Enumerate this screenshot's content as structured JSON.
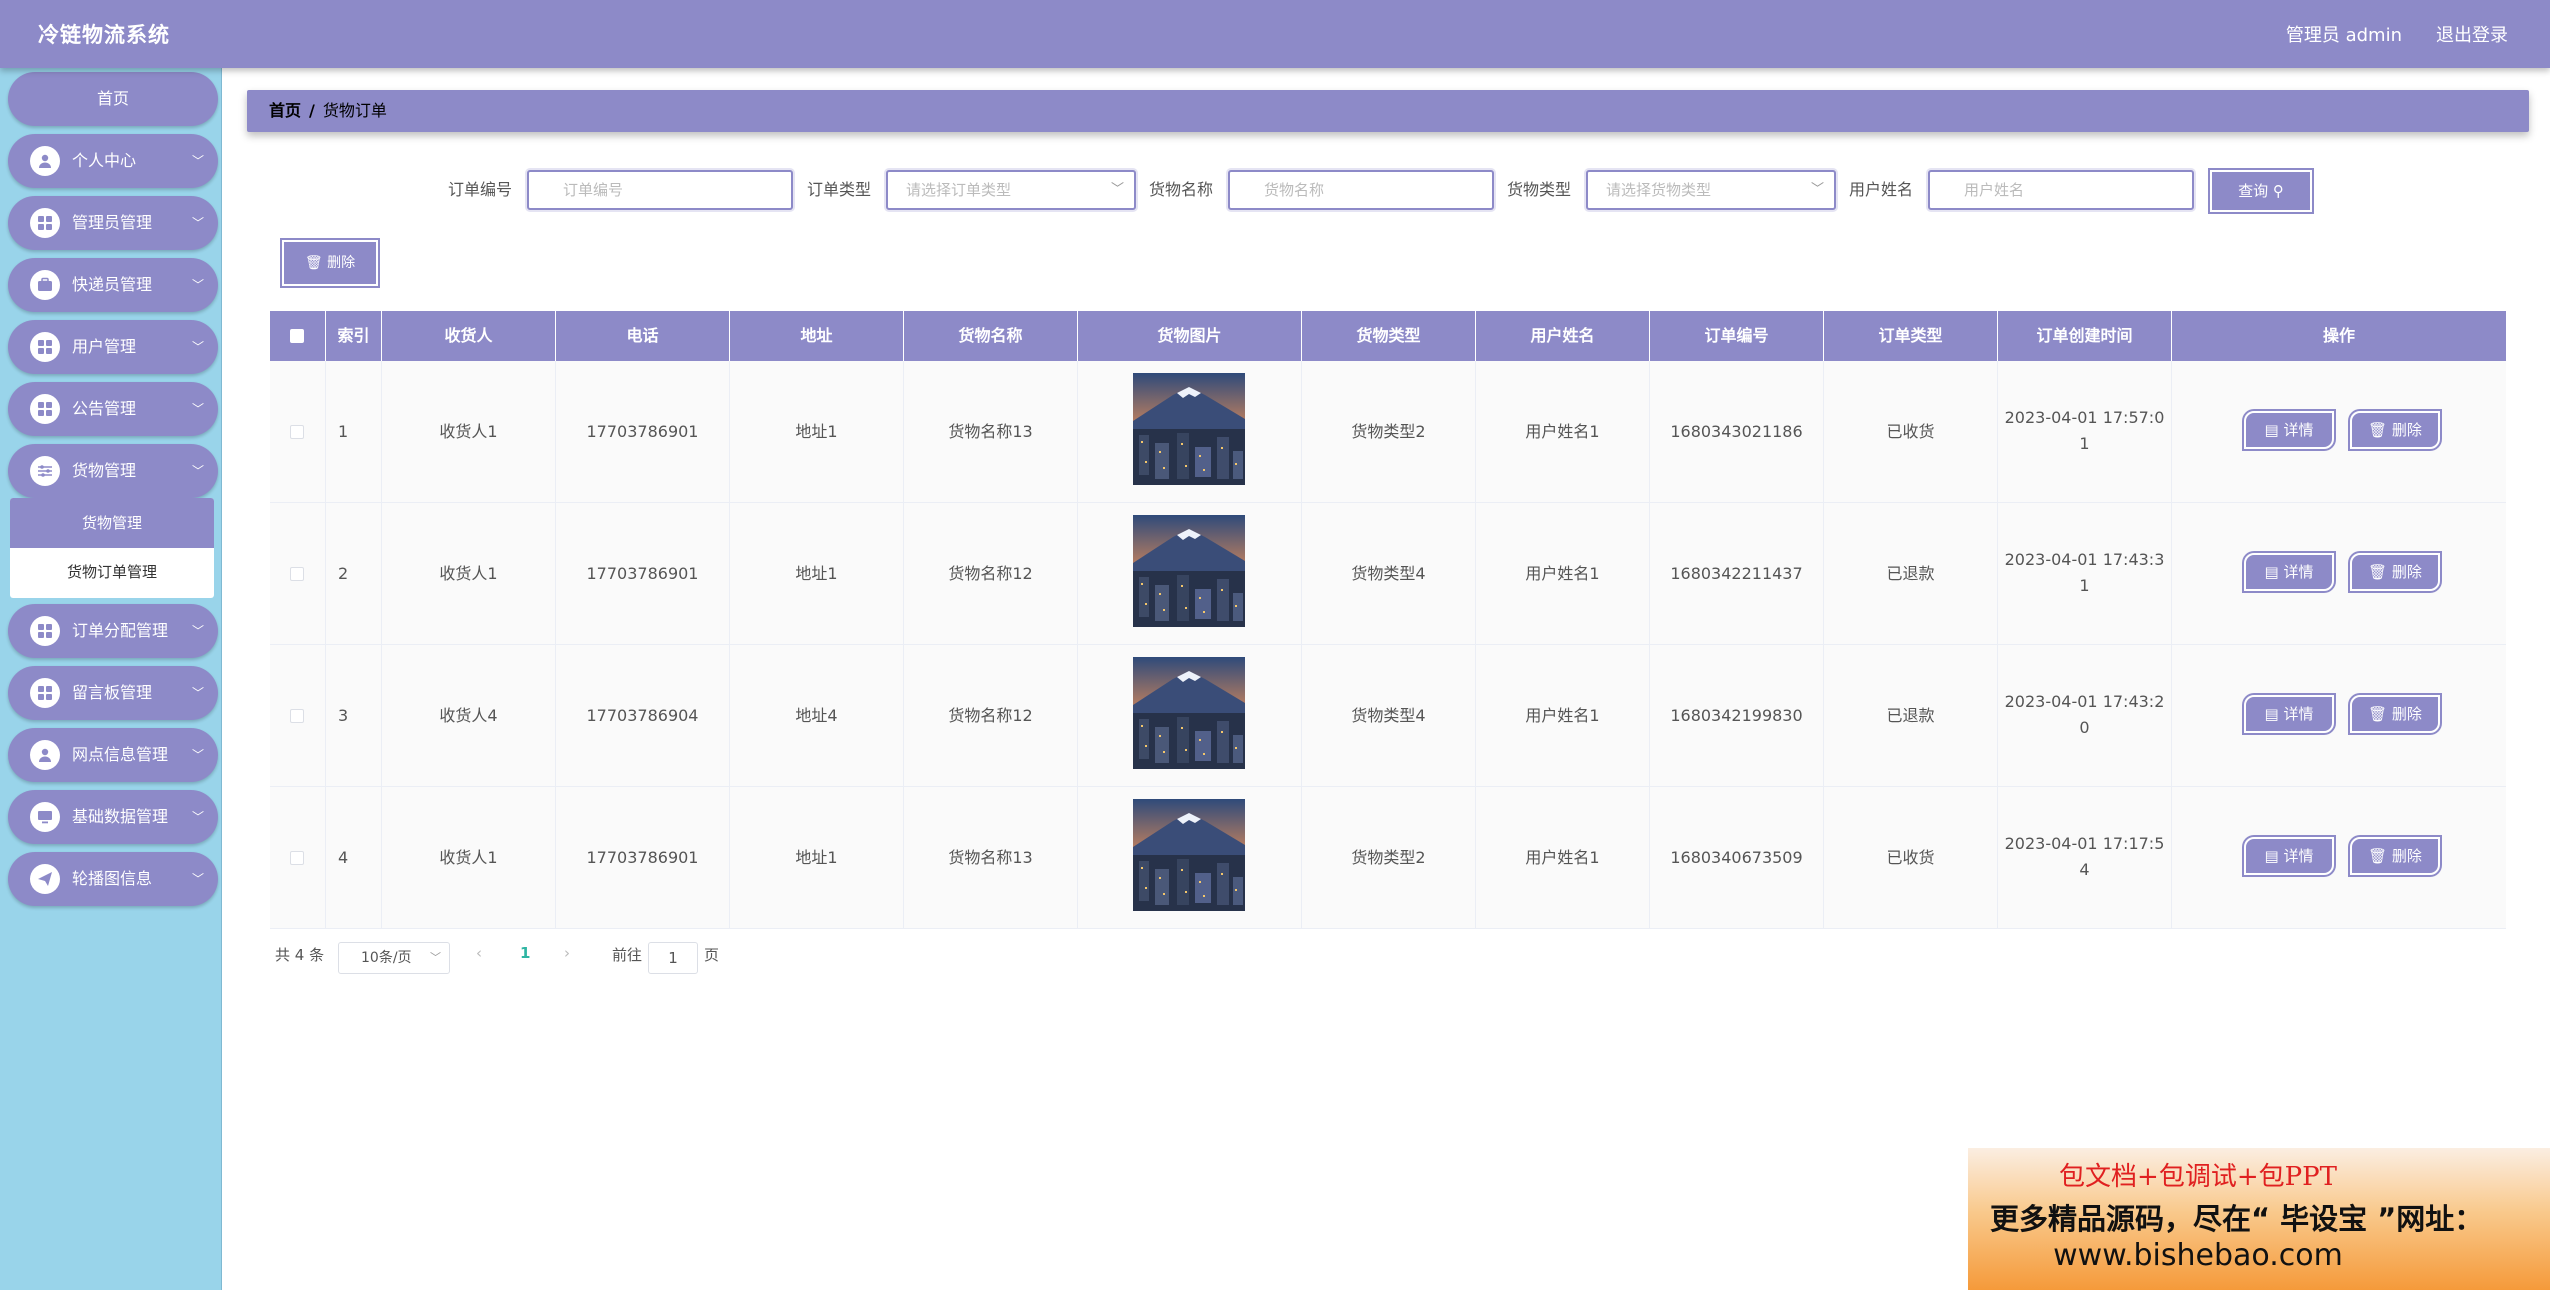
{
  "app": {
    "title": "冷链物流系统",
    "user_label": "管理员 admin",
    "logout_label": "退出登录",
    "accent_color": "#8d8ac8",
    "sidebar_color": "#99d4ea"
  },
  "sidebar": {
    "home": "首页",
    "items": [
      {
        "label": "个人中心",
        "icon": "person-icon"
      },
      {
        "label": "管理员管理",
        "icon": "grid-icon"
      },
      {
        "label": "快递员管理",
        "icon": "briefcase-icon"
      },
      {
        "label": "用户管理",
        "icon": "grid-icon"
      },
      {
        "label": "公告管理",
        "icon": "grid-icon"
      },
      {
        "label": "货物管理",
        "icon": "sliders-icon"
      },
      {
        "label": "订单分配管理",
        "icon": "grid-icon"
      },
      {
        "label": "留言板管理",
        "icon": "grid-icon"
      },
      {
        "label": "网点信息管理",
        "icon": "person-icon"
      },
      {
        "label": "基础数据管理",
        "icon": "monitor-icon"
      },
      {
        "label": "轮播图信息",
        "icon": "send-icon"
      }
    ],
    "submenu": [
      "货物管理",
      "货物订单管理"
    ]
  },
  "breadcrumb": {
    "home": "首页",
    "separator": "/",
    "current": "货物订单"
  },
  "search": {
    "order_no_label": "订单编号",
    "order_no_placeholder": "订单编号",
    "order_type_label": "订单类型",
    "order_type_placeholder": "请选择订单类型",
    "goods_name_label": "货物名称",
    "goods_name_placeholder": "货物名称",
    "goods_type_label": "货物类型",
    "goods_type_placeholder": "请选择货物类型",
    "user_name_label": "用户姓名",
    "user_name_placeholder": "用户姓名",
    "query_button": "查询"
  },
  "toolbar": {
    "delete_button": "删除"
  },
  "table": {
    "headers": [
      "索引",
      "收货人",
      "电话",
      "地址",
      "货物名称",
      "货物图片",
      "货物类型",
      "用户姓名",
      "订单编号",
      "订单类型",
      "订单创建时间",
      "操作"
    ],
    "rows": [
      {
        "index": "1",
        "receiver": "收货人1",
        "phone": "17703786901",
        "address": "地址1",
        "goods_name": "货物名称13",
        "goods_type": "货物类型2",
        "user_name": "用户姓名1",
        "order_no": "1680343021186",
        "order_type": "已收货",
        "time1": "2023-04-01 17:57:0",
        "time2": "1"
      },
      {
        "index": "2",
        "receiver": "收货人1",
        "phone": "17703786901",
        "address": "地址1",
        "goods_name": "货物名称12",
        "goods_type": "货物类型4",
        "user_name": "用户姓名1",
        "order_no": "1680342211437",
        "order_type": "已退款",
        "time1": "2023-04-01 17:43:3",
        "time2": "1"
      },
      {
        "index": "3",
        "receiver": "收货人4",
        "phone": "17703786904",
        "address": "地址4",
        "goods_name": "货物名称12",
        "goods_type": "货物类型4",
        "user_name": "用户姓名1",
        "order_no": "1680342199830",
        "order_type": "已退款",
        "time1": "2023-04-01 17:43:2",
        "time2": "0"
      },
      {
        "index": "4",
        "receiver": "收货人1",
        "phone": "17703786901",
        "address": "地址1",
        "goods_name": "货物名称13",
        "goods_type": "货物类型2",
        "user_name": "用户姓名1",
        "order_no": "1680340673509",
        "order_type": "已收货",
        "time1": "2023-04-01 17:17:5",
        "time2": "4"
      }
    ],
    "detail_button": "详情",
    "delete_button": "删除"
  },
  "pagination": {
    "total": "共 4 条",
    "page_size": "10条/页",
    "current_page": "1",
    "goto_prefix": "前往",
    "goto_value": "1",
    "goto_suffix": "页"
  },
  "ad": {
    "line1": "包文档+包调试+包PPT",
    "line2": "更多精品源码，尽在“ 毕设宝 ”网址：",
    "line3": "www.bishebao.com"
  }
}
